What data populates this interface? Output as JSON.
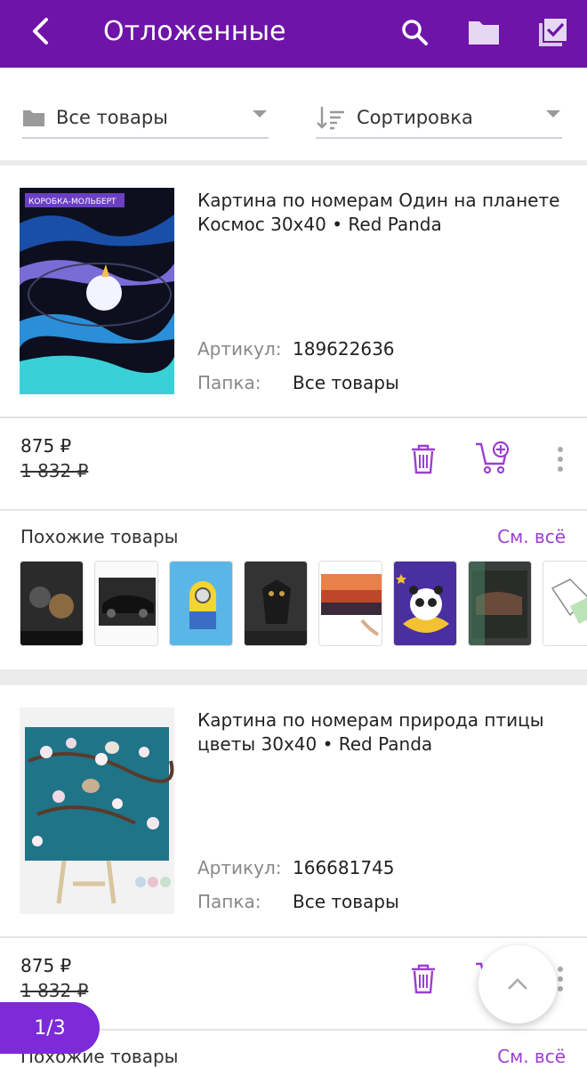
{
  "header": {
    "title": "Отложенные",
    "bg_color": "#6e14a8",
    "actions": [
      "search-icon",
      "folder-icon",
      "select-checkbox-icon"
    ]
  },
  "filters": {
    "folder": "Все товары",
    "sort": "Сортировка"
  },
  "products": [
    {
      "title": "Картина по номерам Один на планете Космос 30x40 • Red Panda",
      "article_label": "Артикул:",
      "article": "189622636",
      "folder_label": "Папка:",
      "folder": "Все товары",
      "price": "875 ₽",
      "old_price": "1 832 ₽",
      "box_label": "КОРОБКА-МОЛЬБЕРТ",
      "similar_label": "Похожие товары",
      "see_all": "См. всё"
    },
    {
      "title": "Картина по номерам природа птицы цветы 30x40 • Red Panda",
      "article_label": "Артикул:",
      "article": "166681745",
      "folder_label": "Папка:",
      "folder": "Все товары",
      "price": "875 ₽",
      "old_price": "1 832 ₽",
      "similar_label": "Похожие товары",
      "see_all": "См. всё"
    }
  ],
  "pager": "1/3",
  "colors": {
    "accent": "#9b3fd1",
    "pager": "#7d2bd8"
  }
}
